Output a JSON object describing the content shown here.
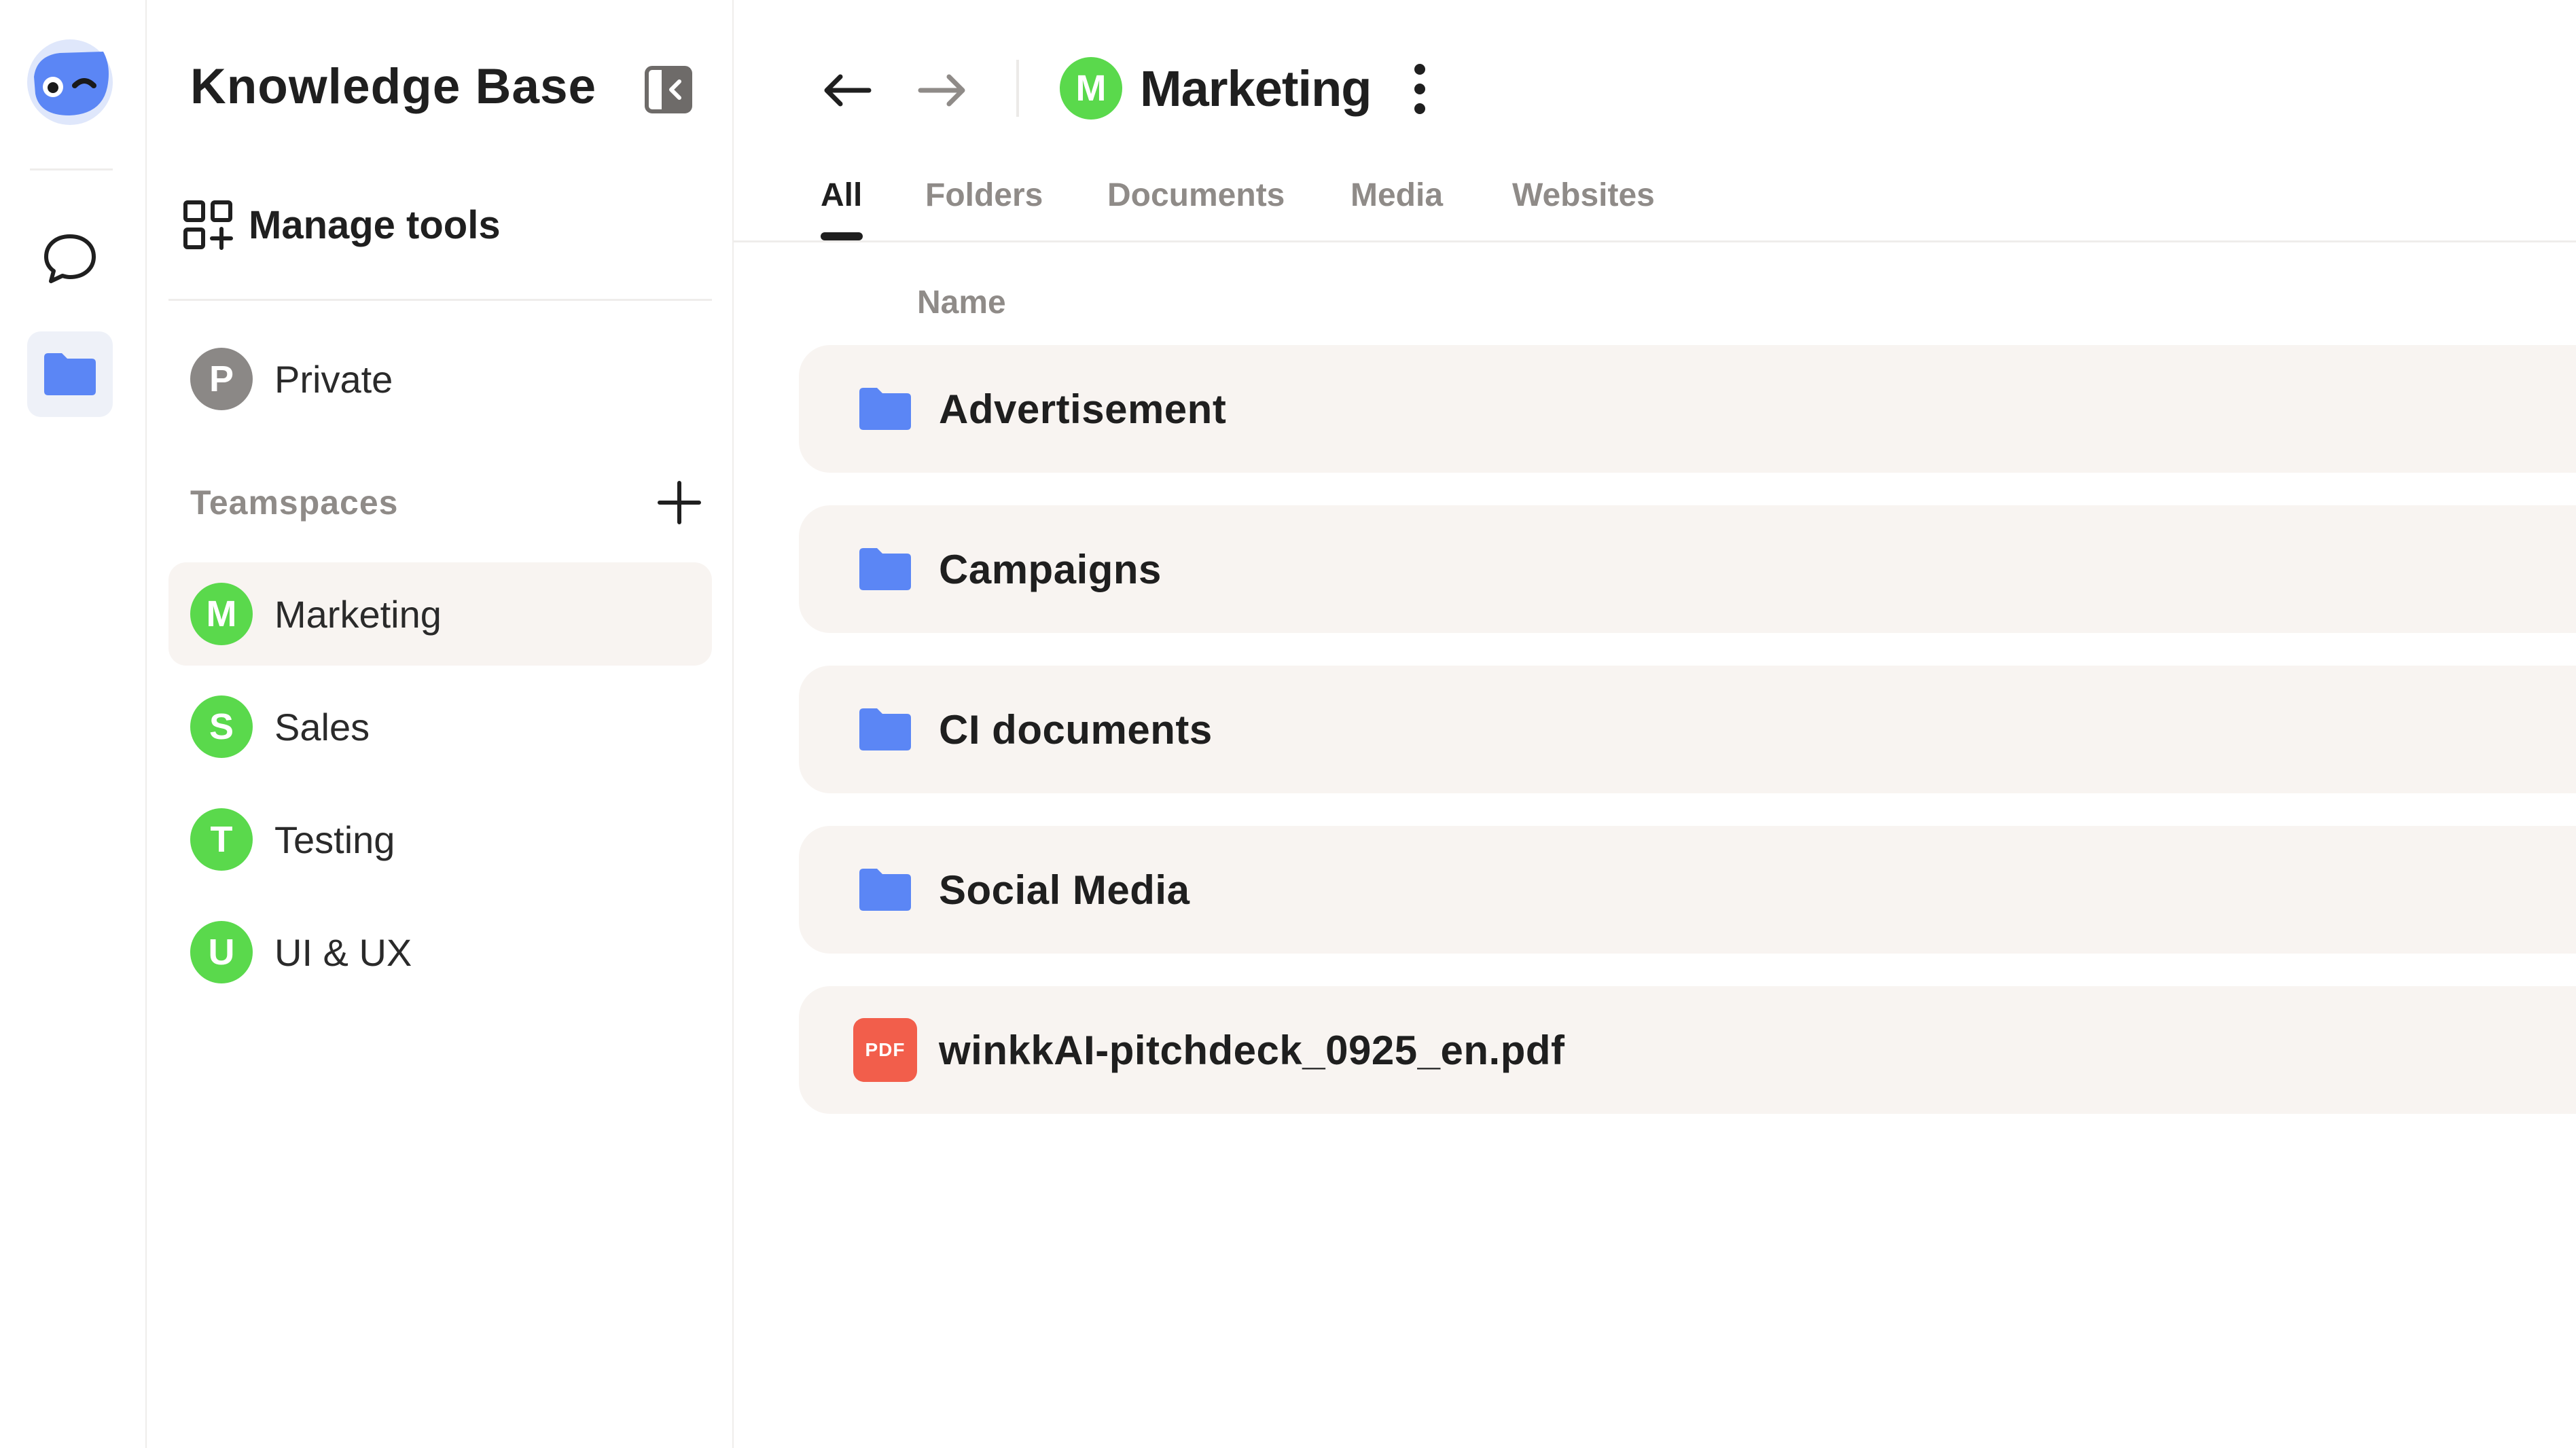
{
  "rail": {
    "logo_icon": "mascot-logo-icon",
    "chat_icon": "chat-bubble-icon",
    "kb_icon": "folder-icon",
    "accent": "#5b86f5"
  },
  "sidebar": {
    "title": "Knowledge Base",
    "collapse_icon": "sidebar-collapse-icon",
    "manage_tools": {
      "label": "Manage tools",
      "icon": "grid-plus-icon"
    },
    "private": {
      "initial": "P",
      "label": "Private"
    },
    "teamspaces_label": "Teamspaces",
    "add_icon": "plus-icon",
    "teamspaces": [
      {
        "initial": "M",
        "label": "Marketing",
        "active": true
      },
      {
        "initial": "S",
        "label": "Sales",
        "active": false
      },
      {
        "initial": "T",
        "label": "Testing",
        "active": false
      },
      {
        "initial": "U",
        "label": "UI & UX",
        "active": false
      }
    ]
  },
  "header": {
    "back_icon": "arrow-left-icon",
    "forward_icon": "arrow-right-icon",
    "space_initial": "M",
    "space_name": "Marketing",
    "more_icon": "kebab-menu-icon"
  },
  "tabs": [
    {
      "label": "All",
      "active": true
    },
    {
      "label": "Folders",
      "active": false
    },
    {
      "label": "Documents",
      "active": false
    },
    {
      "label": "Media",
      "active": false
    },
    {
      "label": "Websites",
      "active": false
    }
  ],
  "list": {
    "column_name": "Name",
    "items": [
      {
        "type": "folder",
        "name": "Advertisement"
      },
      {
        "type": "folder",
        "name": "Campaigns"
      },
      {
        "type": "folder",
        "name": "CI documents"
      },
      {
        "type": "folder",
        "name": "Social Media"
      },
      {
        "type": "pdf",
        "name": "winkkAI-pitchdeck_0925_en.pdf",
        "badge": "PDF"
      }
    ]
  },
  "colors": {
    "avatar_green": "#5ad94c",
    "avatar_gray": "#8b8886",
    "folder_blue": "#5b86f5",
    "pdf_red": "#f25e4b",
    "row_bg": "#f8f4f1"
  }
}
